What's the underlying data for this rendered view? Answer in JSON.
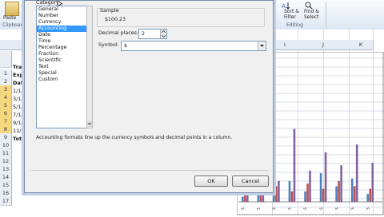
{
  "ribbon": {
    "paste_label": "Paste",
    "clipboard_label": "Clipboard",
    "sort_filter_label": "Sort &\nFilter",
    "find_select_label": "Find &\nSelect",
    "editing_label": "Editing"
  },
  "sheet": {
    "col_headers": [
      "I",
      "J",
      "K"
    ],
    "row_headers": [
      "1",
      "2",
      "3",
      "4",
      "5",
      "6",
      "7",
      "8",
      "9",
      "10",
      "11",
      "12",
      "13",
      "14",
      "15",
      "16",
      "17"
    ],
    "selected_rows": [
      "3",
      "4",
      "5",
      "6",
      "7",
      "8"
    ],
    "cells": [
      "Trav",
      "Expe",
      "Date",
      "1/1/1",
      "3/1/1",
      "5/1/1",
      "7/1/1",
      "9/1/1",
      "11/1",
      "Tota"
    ]
  },
  "dialog": {
    "category_label": "Category:",
    "categories": [
      "General",
      "Number",
      "Currency",
      "Accounting",
      "Date",
      "Time",
      "Percentage",
      "Fraction",
      "Scientific",
      "Text",
      "Special",
      "Custom"
    ],
    "selected_category": "Accounting",
    "sample_label": "Sample",
    "sample_value": "$100.23",
    "decimal_label": "Decimal places:",
    "decimal_value": "2",
    "symbol_label": "Symbol:",
    "symbol_value": "$",
    "description": "Accounting formats line up the currency symbols and decimal points in a column.",
    "ok_label": "OK",
    "cancel_label": "Cancel"
  },
  "chart": {
    "y_axis_tick": "$-",
    "colors": {
      "series1": "#4f81bd",
      "series2": "#c0504d",
      "series3": "#8064a2"
    }
  },
  "chart_data": {
    "type": "bar",
    "categories": [
      "1",
      "2",
      "3",
      "4",
      "5",
      "6",
      "7",
      "8",
      "9"
    ],
    "series": [
      {
        "values": [
          10,
          35,
          25,
          40,
          20,
          55,
          30,
          45,
          15
        ]
      },
      {
        "values": [
          25,
          15,
          30,
          20,
          35,
          25,
          40,
          30,
          25
        ]
      },
      {
        "values": [
          30,
          120,
          40,
          140,
          60,
          95,
          70,
          110,
          75
        ]
      }
    ]
  }
}
